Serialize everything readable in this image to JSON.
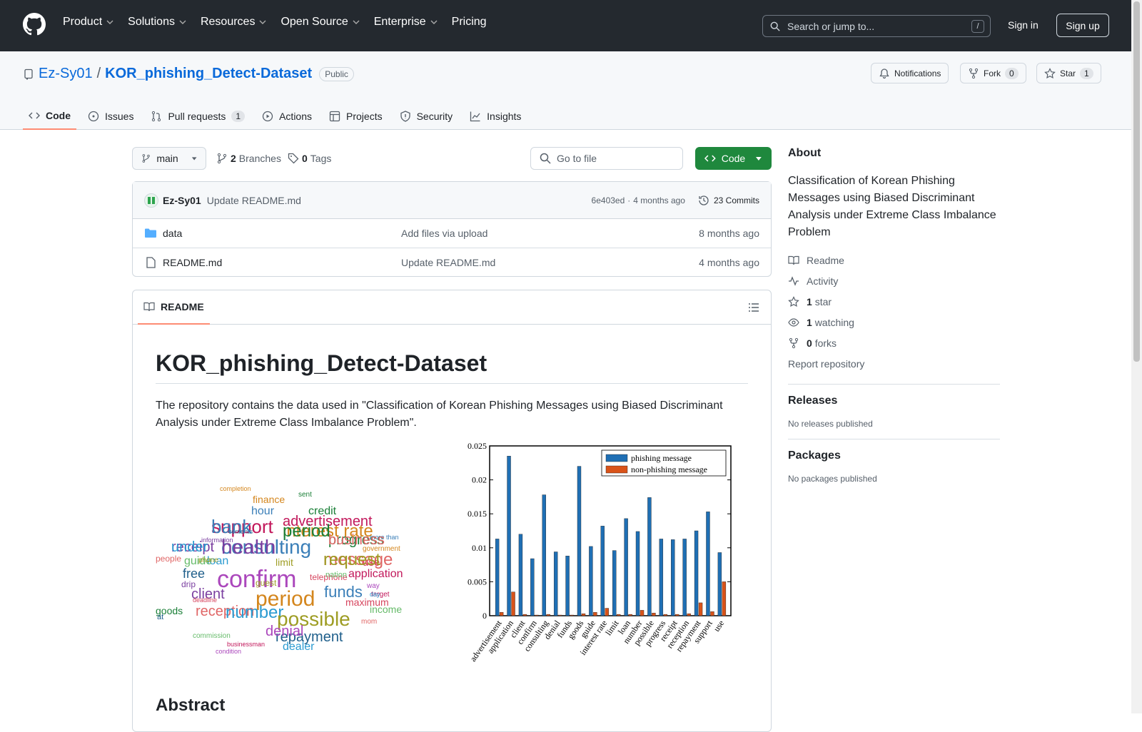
{
  "nav": {
    "items": [
      "Product",
      "Solutions",
      "Resources",
      "Open Source",
      "Enterprise",
      "Pricing"
    ],
    "search_placeholder": "Search or jump to...",
    "slash": "/",
    "signin": "Sign in",
    "signup": "Sign up"
  },
  "repo": {
    "owner": "Ez-Sy01",
    "sep": "/",
    "name": "KOR_phishing_Detect-Dataset",
    "visibility": "Public",
    "notifications": "Notifications",
    "fork": "Fork",
    "fork_count": "0",
    "star": "Star",
    "star_count": "1"
  },
  "tabs": [
    {
      "label": "Code"
    },
    {
      "label": "Issues"
    },
    {
      "label": "Pull requests",
      "count": "1"
    },
    {
      "label": "Actions"
    },
    {
      "label": "Projects"
    },
    {
      "label": "Security"
    },
    {
      "label": "Insights"
    }
  ],
  "toolbar": {
    "branch": "main",
    "branches_num": "2",
    "branches": "Branches",
    "tags_num": "0",
    "tags": "Tags",
    "goto": "Go to file",
    "code": "Code"
  },
  "commit": {
    "author": "Ez-Sy01",
    "message": "Update README.md",
    "hash": "6e403ed",
    "sep": "·",
    "time": "4 months ago",
    "commits": "23 Commits"
  },
  "files": [
    {
      "name": "data",
      "msg": "Add files via upload",
      "time": "8 months ago"
    },
    {
      "name": "README.md",
      "msg": "Update README.md",
      "time": "4 months ago"
    }
  ],
  "readme": {
    "tab": "README",
    "title": "KOR_phishing_Detect-Dataset",
    "desc": "The repository contains the data used in \"Classification of Korean Phishing Messages using Biased Discriminant Analysis under Extreme Class Imbalance Problem\".",
    "abstract": "Abstract"
  },
  "wordcloud": [
    "support",
    "interest rate",
    "consulting",
    "progress",
    "receipt",
    "message",
    "loan",
    "limit",
    "use",
    "free",
    "guide",
    "confirm",
    "application",
    "period",
    "funds",
    "goods",
    "client",
    "reception",
    "number",
    "possible",
    "maximum",
    "repayment",
    "income",
    "denial",
    "advertisement",
    "finance",
    "hour",
    "credit",
    "drip",
    "people",
    "dealer",
    "guest",
    "telephone",
    "at",
    "nation",
    "way",
    "target",
    "government",
    "more than",
    "sent",
    "information",
    "mom",
    "day",
    "phone",
    "deadline",
    "contents",
    "commission",
    "condition",
    "businessman",
    "completion",
    "bank",
    "period",
    "health",
    "business",
    "under",
    "request"
  ],
  "chart_data": {
    "type": "bar",
    "categories": [
      "advertisement",
      "application",
      "client",
      "confirm",
      "consulting",
      "denial",
      "funds",
      "goods",
      "guide",
      "interest rate",
      "limit",
      "loan",
      "number",
      "possible",
      "progress",
      "receipt",
      "reception",
      "repayment",
      "support",
      "use"
    ],
    "series": [
      {
        "name": "phishing message",
        "color": "#1f6fb4",
        "values": [
          0.0113,
          0.0235,
          0.012,
          0.0084,
          0.0178,
          0.0094,
          0.0088,
          0.022,
          0.0102,
          0.0132,
          0.0096,
          0.0143,
          0.0124,
          0.0174,
          0.0113,
          0.0112,
          0.0113,
          0.0125,
          0.0153,
          0.0093
        ]
      },
      {
        "name": "non-phishing message",
        "color": "#d95319",
        "values": [
          0.0005,
          0.0035,
          0.0002,
          0.0001,
          0.0002,
          0.0001,
          0.0001,
          0.0003,
          0.0005,
          0.0011,
          0.0002,
          0.0002,
          0.0008,
          0.0004,
          0.0002,
          0.0002,
          0.0003,
          0.0019,
          0.0006,
          0.005
        ]
      }
    ],
    "yticks": [
      "0",
      "0.005",
      "0.01",
      "0.015",
      "0.02",
      "0.025"
    ],
    "ylim": [
      0,
      0.025
    ]
  },
  "about": {
    "title": "About",
    "desc": "Classification of Korean Phishing Messages using Biased Discriminant Analysis under Extreme Class Imbalance Problem",
    "readme": "Readme",
    "activity": "Activity",
    "stars_num": "1",
    "stars": "star",
    "watching_num": "1",
    "watching": "watching",
    "forks_num": "0",
    "forks": "forks",
    "report": "Report repository",
    "releases": "Releases",
    "no_releases": "No releases published",
    "packages": "Packages",
    "no_packages": "No packages published"
  },
  "colors": {
    "accent": "#0969da",
    "green": "#1f883d"
  }
}
